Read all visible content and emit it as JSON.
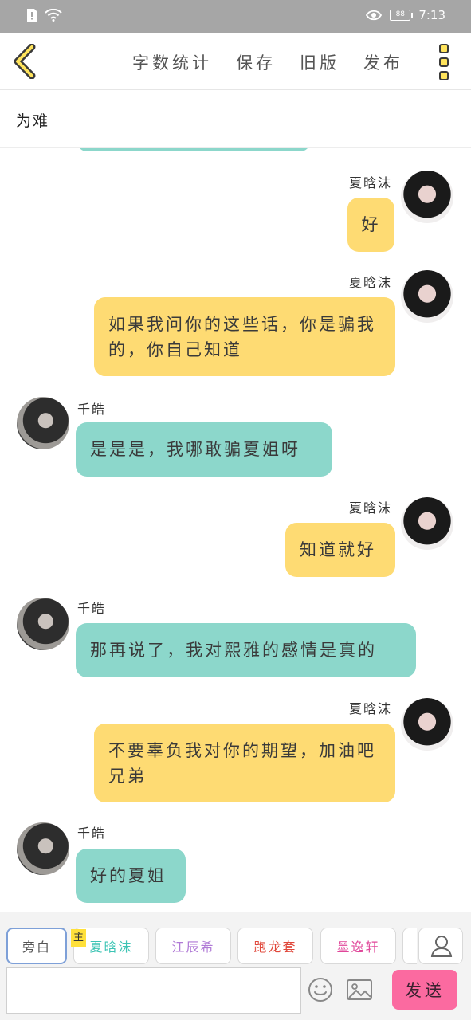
{
  "status": {
    "battery": "88",
    "time": "7:13"
  },
  "toolbar": {
    "word_count": "字数统计",
    "save": "保存",
    "old_version": "旧版",
    "publish": "发布"
  },
  "chapter": {
    "title": "为难"
  },
  "messages": [
    {
      "side": "right",
      "name": "夏晗沫",
      "text": "好"
    },
    {
      "side": "right",
      "name": "夏晗沫",
      "text": "如果我问你的这些话，你是骗我的，你自己知道"
    },
    {
      "side": "left",
      "name": "千皓",
      "text": "是是是，我哪敢骗夏姐呀"
    },
    {
      "side": "right",
      "name": "夏晗沫",
      "text": "知道就好"
    },
    {
      "side": "left",
      "name": "千皓",
      "text": "那再说了，我对熙雅的感情是真的"
    },
    {
      "side": "right",
      "name": "夏晗沫",
      "text": "不要辜负我对你的期望，加油吧兄弟"
    },
    {
      "side": "left",
      "name": "千皓",
      "text": "好的夏姐"
    }
  ],
  "roles": {
    "narration": "旁白",
    "main_badge": "主",
    "items": [
      {
        "label": "夏晗沫",
        "color": "#3cc4b4"
      },
      {
        "label": "江辰希",
        "color": "#b07ad6"
      },
      {
        "label": "跑龙套",
        "color": "#e0483b"
      },
      {
        "label": "墨逸轩",
        "color": "#e0479a"
      }
    ]
  },
  "composer": {
    "placeholder": "",
    "send_label": "发送"
  },
  "colors": {
    "status_bar": "#a6a6a6",
    "right_bubble": "#fedb73",
    "left_bubble": "#8cd7cb",
    "send_button": "#fb6aa0",
    "back_icon": "#ffe45c"
  }
}
